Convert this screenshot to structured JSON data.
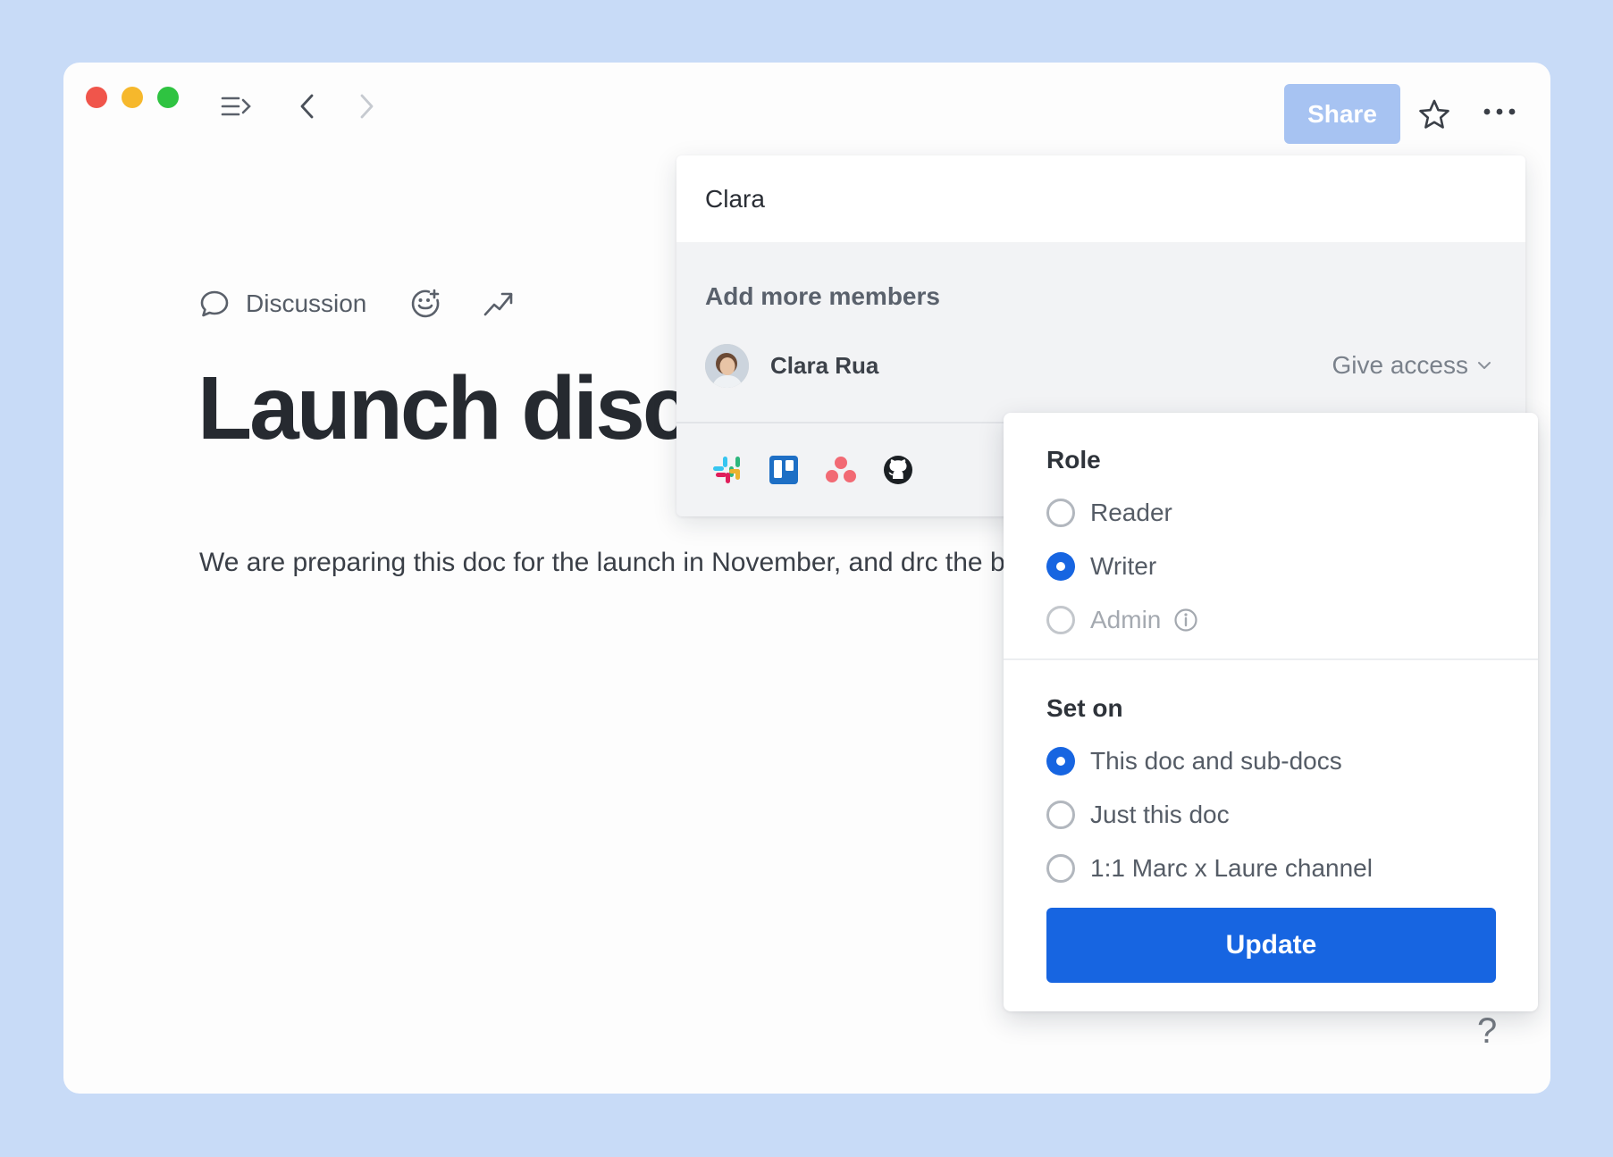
{
  "toolbar": {
    "share_label": "Share",
    "icons": [
      "sidebar-toggle-icon",
      "back-icon",
      "forward-icon",
      "star-icon",
      "more-icon"
    ]
  },
  "document": {
    "discussion_label": "Discussion",
    "title": "Launch disc",
    "body": "We are preparing this doc for the launch in November, and drc the ball rolling."
  },
  "share_popup": {
    "search_value": "Clara",
    "add_more_label": "Add more members",
    "member": {
      "name": "Clara Rua",
      "access_label": "Give access"
    },
    "integrations": [
      "slack-icon",
      "trello-icon",
      "asana-icon",
      "github-icon"
    ]
  },
  "role_menu": {
    "role_title": "Role",
    "roles": [
      {
        "label": "Reader",
        "checked": false,
        "disabled": false
      },
      {
        "label": "Writer",
        "checked": true,
        "disabled": false
      },
      {
        "label": "Admin",
        "checked": false,
        "disabled": true
      }
    ],
    "set_on_title": "Set on",
    "scopes": [
      {
        "label": "This doc and sub-docs",
        "checked": true
      },
      {
        "label": "Just this doc",
        "checked": false
      },
      {
        "label": "1:1 Marc x Laure channel",
        "checked": false
      }
    ],
    "update_label": "Update"
  },
  "help_label": "?",
  "colors": {
    "background": "#c8dbf7",
    "primary": "#1765e1",
    "share_button": "#a7c3f2"
  }
}
